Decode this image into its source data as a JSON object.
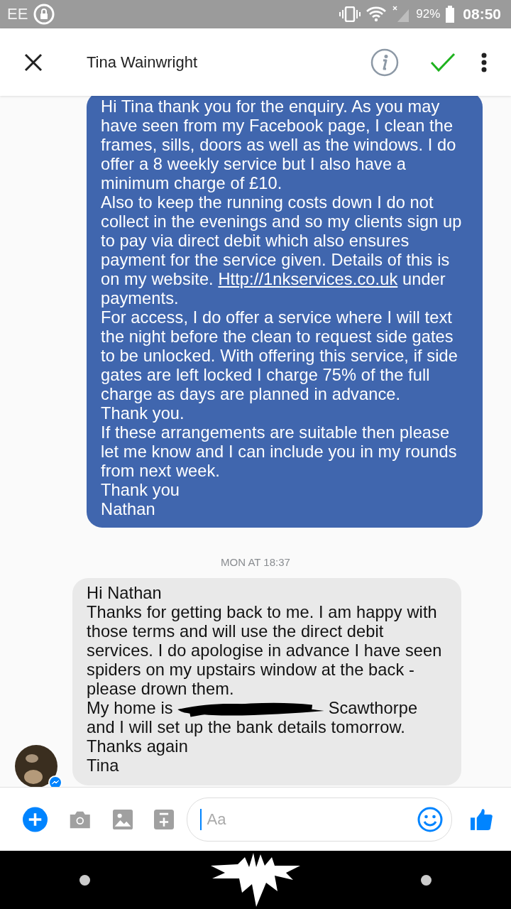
{
  "status_bar": {
    "carrier": "EE",
    "battery": "92%",
    "time": "08:50"
  },
  "header": {
    "title": "Tina Wainwright"
  },
  "messages": [
    {
      "kind": "sent",
      "paragraphs": [
        {
          "kind": "text",
          "text": "Hi Tina thank you for the enquiry. As you may have seen from my Facebook page, I clean the frames, sills, doors as well as the windows. I do offer a 8 weekly service but I also have a minimum charge of £10."
        },
        {
          "kind": "link",
          "before": "Also to keep the running costs down I do not collect in the evenings and so my clients sign up to pay via direct debit which also ensures payment for the service given. Details of this is on my website. ",
          "link": "Http://1nkservices.co.uk",
          "after": " under payments."
        },
        {
          "kind": "text",
          "text": "For access, I do offer a service where I will text the night before the clean to request side gates to be unlocked. With offering this service, if side gates are left locked I charge 75% of the full charge as days are planned in advance."
        },
        {
          "kind": "text",
          "text": "Thank you."
        },
        {
          "kind": "text",
          "text": "If these arrangements are suitable then please let me know and I can include you in my rounds from next week."
        },
        {
          "kind": "text",
          "text": "Thank you"
        },
        {
          "kind": "text",
          "text": "Nathan"
        }
      ]
    },
    {
      "kind": "timestamp",
      "text": "MON AT 18:37"
    },
    {
      "kind": "received",
      "paragraphs": [
        {
          "kind": "text",
          "text": "Hi Nathan"
        },
        {
          "kind": "text",
          "text": "Thanks for getting back to me. I am happy with those terms and will use the direct debit services. I do apologise in advance I have seen spiders on my upstairs window at the back - please drown them."
        },
        {
          "kind": "redacted",
          "before": "My home is",
          "after": "Scawthorpe and I will set up the bank details tomorrow."
        },
        {
          "kind": "text",
          "text": "Thanks again"
        },
        {
          "kind": "text",
          "text": "Tina"
        }
      ]
    }
  ],
  "composer": {
    "placeholder": "Aa"
  }
}
